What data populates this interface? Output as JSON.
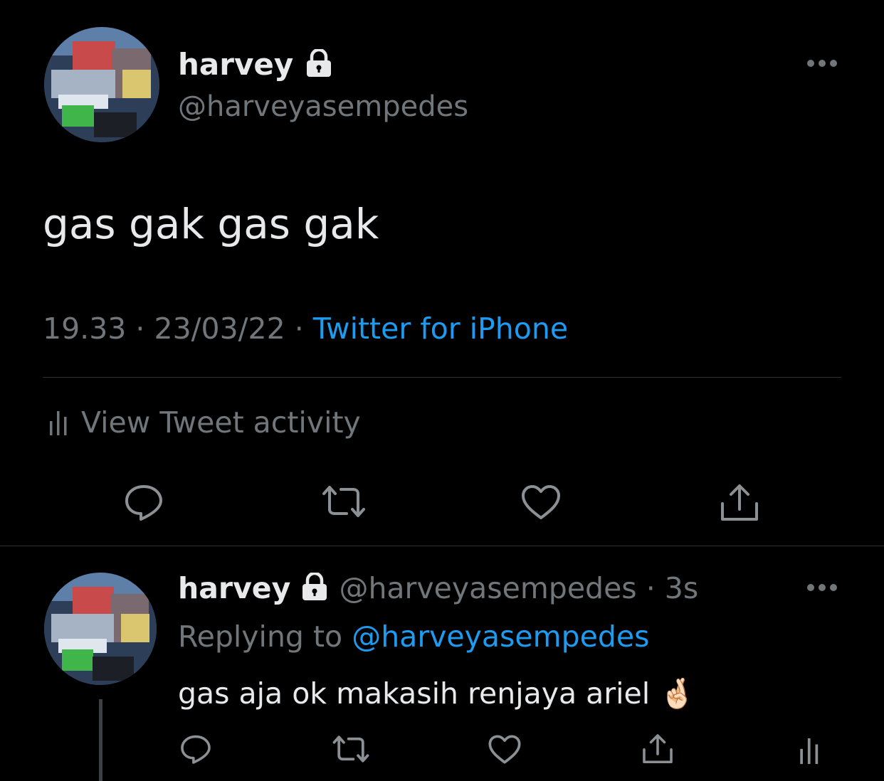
{
  "main_tweet": {
    "display_name": "harvey",
    "handle": "@harveyasempedes",
    "text": "gas gak gas gak",
    "time": "19.33",
    "separator": "·",
    "date": "23/03/22",
    "source": "Twitter for iPhone",
    "activity_label": "View Tweet activity",
    "actions": [
      "reply-icon",
      "retweet-icon",
      "like-icon",
      "share-icon"
    ]
  },
  "reply_tweet": {
    "display_name": "harvey",
    "handle_time": "@harveyasempedes · 3s",
    "replying_prefix": "Replying to",
    "replying_handle": "@harveyasempedes",
    "text": "gas aja ok makasih renjaya ariel",
    "emoji": "🤞🏻",
    "actions": [
      "reply-icon",
      "retweet-icon",
      "like-icon",
      "share-icon",
      "analytics-icon"
    ]
  },
  "colors": {
    "background": "#000000",
    "text": "#e7e9ea",
    "muted": "#71767b",
    "link": "#1d9bf0",
    "divider": "#2f3336"
  }
}
